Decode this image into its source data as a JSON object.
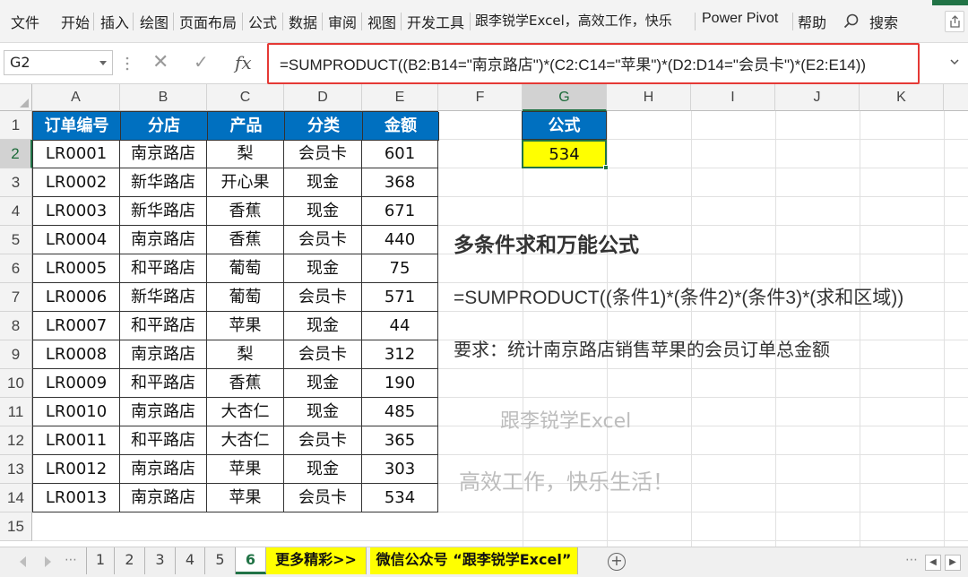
{
  "ribbon": {
    "tabs": [
      "文件",
      "开始",
      "插入",
      "绘图",
      "页面布局",
      "公式",
      "数据",
      "审阅",
      "视图",
      "开发工具",
      "跟李锐学Excel，高效工作，快乐",
      "Power Pivot",
      "帮助"
    ],
    "search_label": "搜索"
  },
  "formula_bar": {
    "name_box": "G2",
    "cancel_icon": "✕",
    "enter_icon": "✓",
    "fx_label": "fx",
    "formula": "=SUMPRODUCT((B2:B14=\"南京路店\")*(C2:C14=\"苹果\")*(D2:D14=\"会员卡\")*(E2:E14))"
  },
  "columns": [
    "A",
    "B",
    "C",
    "D",
    "E",
    "F",
    "G",
    "H",
    "I",
    "J",
    "K"
  ],
  "rows": [
    "1",
    "2",
    "3",
    "4",
    "5",
    "6",
    "7",
    "8",
    "9",
    "10",
    "11",
    "12",
    "13",
    "14",
    "15"
  ],
  "table": {
    "headers": [
      "订单编号",
      "分店",
      "产品",
      "分类",
      "金额"
    ],
    "rows": [
      [
        "LR0001",
        "南京路店",
        "梨",
        "会员卡",
        "601"
      ],
      [
        "LR0002",
        "新华路店",
        "开心果",
        "现金",
        "368"
      ],
      [
        "LR0003",
        "新华路店",
        "香蕉",
        "现金",
        "671"
      ],
      [
        "LR0004",
        "南京路店",
        "香蕉",
        "会员卡",
        "440"
      ],
      [
        "LR0005",
        "和平路店",
        "葡萄",
        "现金",
        "75"
      ],
      [
        "LR0006",
        "新华路店",
        "葡萄",
        "会员卡",
        "571"
      ],
      [
        "LR0007",
        "和平路店",
        "苹果",
        "现金",
        "44"
      ],
      [
        "LR0008",
        "南京路店",
        "梨",
        "会员卡",
        "312"
      ],
      [
        "LR0009",
        "和平路店",
        "香蕉",
        "现金",
        "190"
      ],
      [
        "LR0010",
        "南京路店",
        "大杏仁",
        "现金",
        "485"
      ],
      [
        "LR0011",
        "和平路店",
        "大杏仁",
        "会员卡",
        "365"
      ],
      [
        "LR0012",
        "南京路店",
        "苹果",
        "现金",
        "303"
      ],
      [
        "LR0013",
        "南京路店",
        "苹果",
        "会员卡",
        "534"
      ]
    ]
  },
  "result": {
    "header": "公式",
    "value": "534"
  },
  "notes": {
    "title": "多条件求和万能公式",
    "formula": "=SUMPRODUCT((条件1)*(条件2)*(条件3)*(求和区域))",
    "requirement": "要求：统计南京路店销售苹果的会员订单总金额",
    "watermark1": "跟李锐学Excel",
    "watermark2": "高效工作，快乐生活！"
  },
  "sheet_tabs": {
    "tabs": [
      "1",
      "2",
      "3",
      "4",
      "5",
      "6"
    ],
    "active": "6",
    "promo1": "更多精彩>>",
    "promo2": "微信公众号 “跟李锐学Excel”",
    "add_label": "+",
    "dots": "⋯"
  },
  "colors": {
    "header_blue": "#0070c0",
    "highlight_yellow": "#ffff00",
    "excel_green": "#217346",
    "formula_box_red": "#e53935"
  }
}
